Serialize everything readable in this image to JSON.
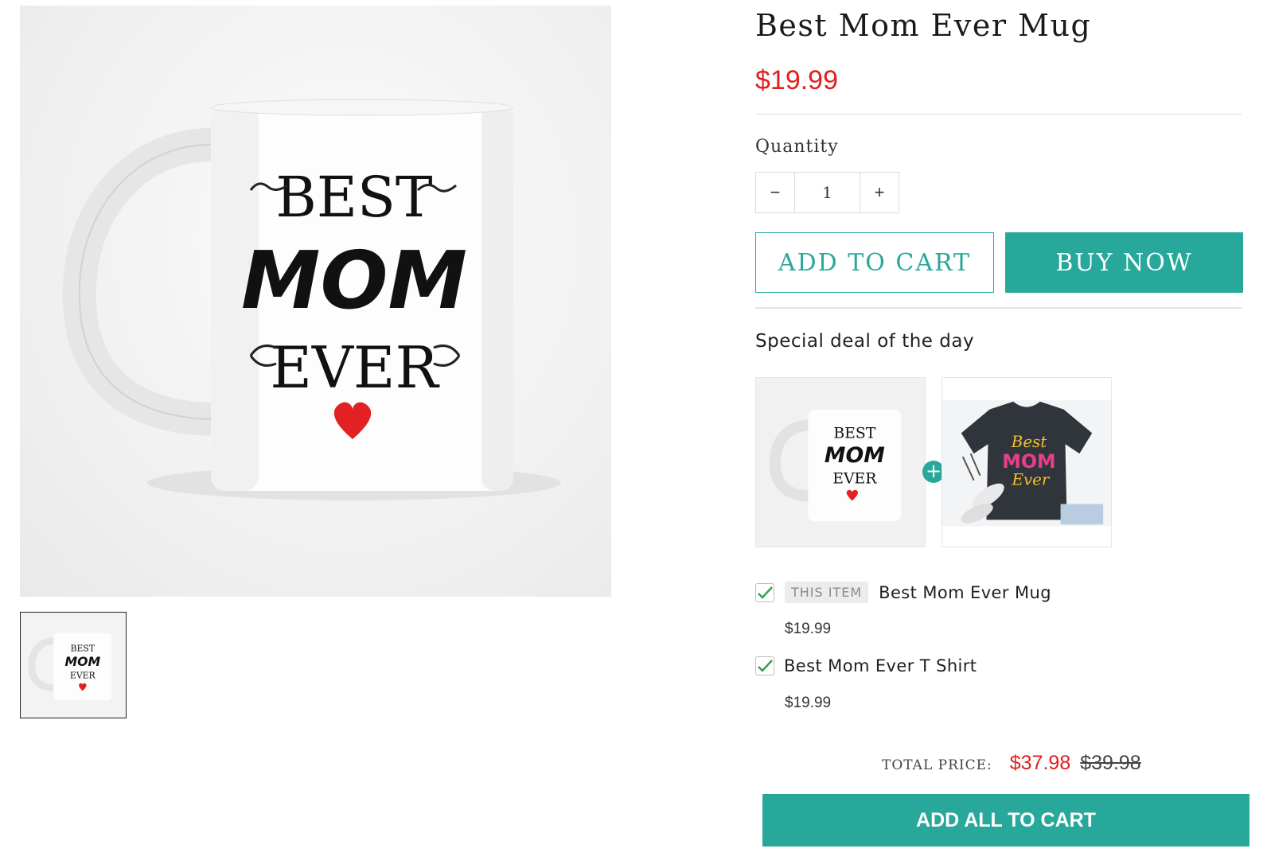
{
  "product": {
    "title": "Best Mom Ever Mug",
    "price": "$19.99",
    "quantity_label": "Quantity",
    "quantity_value": "1",
    "decrement_symbol": "−",
    "increment_symbol": "+",
    "add_to_cart_label": "ADD TO CART",
    "buy_now_label": "BUY NOW"
  },
  "gallery": {
    "mug_print": [
      "BEST",
      "MOM",
      "EVER"
    ]
  },
  "deal": {
    "heading": "Special deal of the day",
    "plus_symbol": "+",
    "tshirt_print": [
      "Best",
      "MOM",
      "Ever"
    ],
    "items": [
      {
        "tag": "THIS ITEM",
        "name": "Best Mom Ever Mug",
        "price": "$19.99",
        "checked": true
      },
      {
        "name": "Best Mom Ever T Shirt",
        "price": "$19.99",
        "checked": true
      }
    ],
    "total_label": "TOTAL PRICE:",
    "total_price": "$37.98",
    "total_original": "$39.98",
    "add_all_label": "ADD ALL TO CART"
  },
  "colors": {
    "accent": "#28a89a",
    "price_red": "#e02020",
    "check_green": "#2e9e4f"
  }
}
